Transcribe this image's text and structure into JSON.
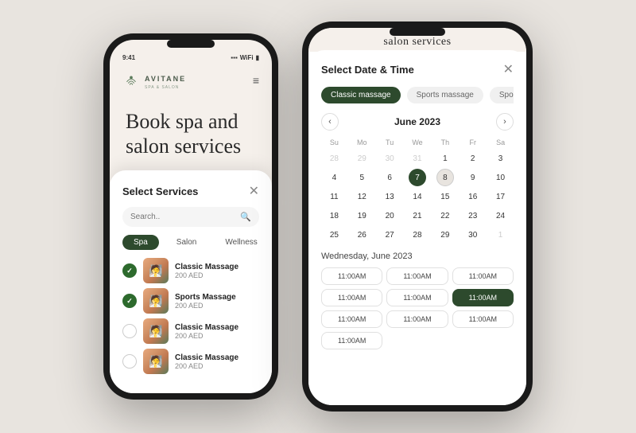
{
  "phone1": {
    "status_time": "9:41",
    "app_name": "AVITANE",
    "app_sub": "SPA & SALON",
    "hero": "Book spa and\nsalon services",
    "modal_title": "Select Services",
    "search_placeholder": "Search..",
    "tabs": [
      "Spa",
      "Salon",
      "Wellness"
    ],
    "active_tab": "Spa",
    "services": [
      {
        "name": "Classic Massage",
        "price": "200 AED",
        "checked": true
      },
      {
        "name": "Sports Massage",
        "price": "200 AED",
        "checked": true
      },
      {
        "name": "Classic Massage",
        "price": "200 AED",
        "checked": false
      },
      {
        "name": "Classic Massage",
        "price": "200 AED",
        "checked": false
      }
    ]
  },
  "phone2": {
    "banner_title": "salon services",
    "modal_title": "Select Date & Time",
    "service_tabs": [
      "Classic massage",
      "Sports massage",
      "Spo"
    ],
    "active_service_tab": "Classic massage",
    "calendar": {
      "month": "June 2023",
      "days_of_week": [
        "Su",
        "Mo",
        "Tu",
        "We",
        "Th",
        "Fr",
        "Sa"
      ],
      "prev_days": [
        28,
        29,
        30,
        31
      ],
      "days": [
        1,
        2,
        3,
        4,
        5,
        6,
        7,
        8,
        9,
        10,
        11,
        12,
        13,
        14,
        15,
        16,
        17,
        18,
        19,
        20,
        21,
        22,
        23,
        24,
        25,
        26,
        27,
        28,
        29,
        30
      ],
      "next_days": [
        1
      ],
      "today": 7,
      "selected": 8
    },
    "date_label": "Wednesday, June 2023",
    "time_slots": [
      "11:00AM",
      "11:00AM",
      "11:00AM",
      "11:00AM",
      "11:00AM",
      "11:00AM",
      "11:00AM",
      "11:00AM",
      "11:00AM",
      "11:00AM"
    ],
    "selected_slot": 5
  }
}
